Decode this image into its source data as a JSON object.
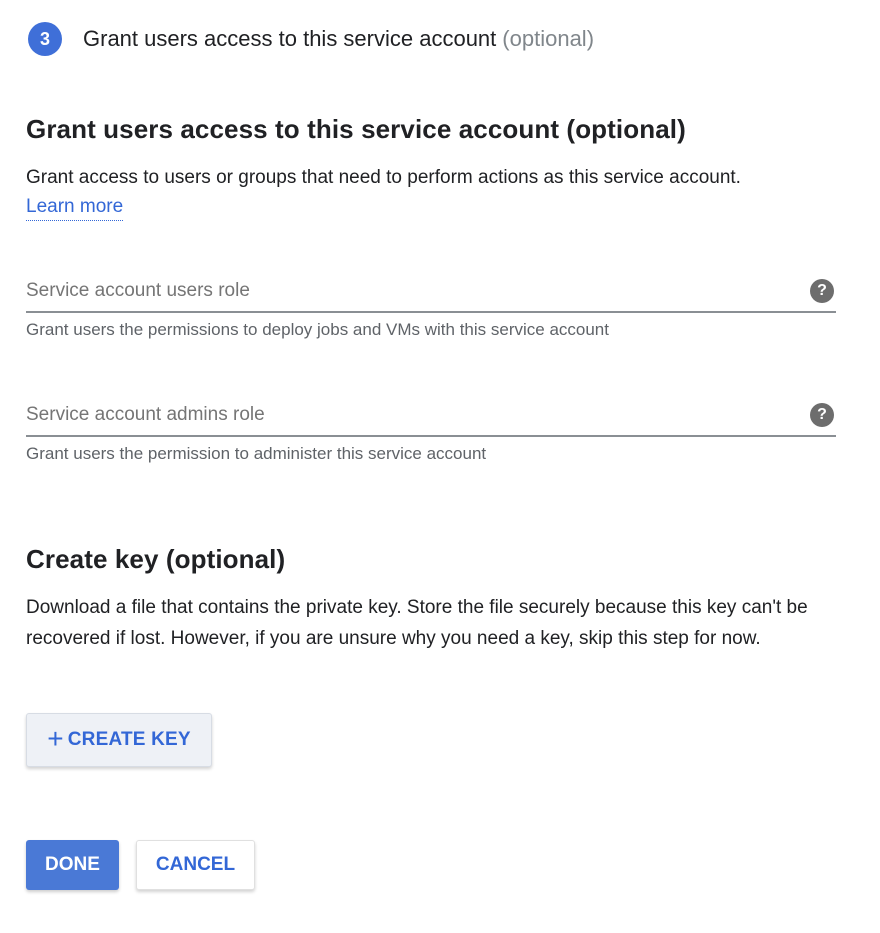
{
  "step": {
    "number": "3",
    "title": "Grant users access to this service account",
    "optional": "(optional)"
  },
  "grant_section": {
    "heading": "Grant users access to this service account (optional)",
    "description": "Grant access to users or groups that need to perform actions as this service account.",
    "learn_more": "Learn more"
  },
  "fields": {
    "users_role": {
      "placeholder": "Service account users role",
      "value": "",
      "hint": "Grant users the permissions to deploy jobs and VMs with this service account",
      "help_icon": "help-icon"
    },
    "admins_role": {
      "placeholder": "Service account admins role",
      "value": "",
      "hint": "Grant users the permission to administer this service account",
      "help_icon": "help-icon"
    }
  },
  "key_section": {
    "heading": "Create key (optional)",
    "description": "Download a file that contains the private key. Store the file securely because this key can't be recovered if lost. However, if you are unsure why you need a key, skip this step for now.",
    "create_key_label": "CREATE KEY",
    "create_key_icon": "plus-icon"
  },
  "actions": {
    "done_label": "DONE",
    "cancel_label": "CANCEL"
  },
  "colors": {
    "accent": "#3367d6",
    "step_badge": "#3f6fd8",
    "primary_button": "#4a79d6"
  }
}
